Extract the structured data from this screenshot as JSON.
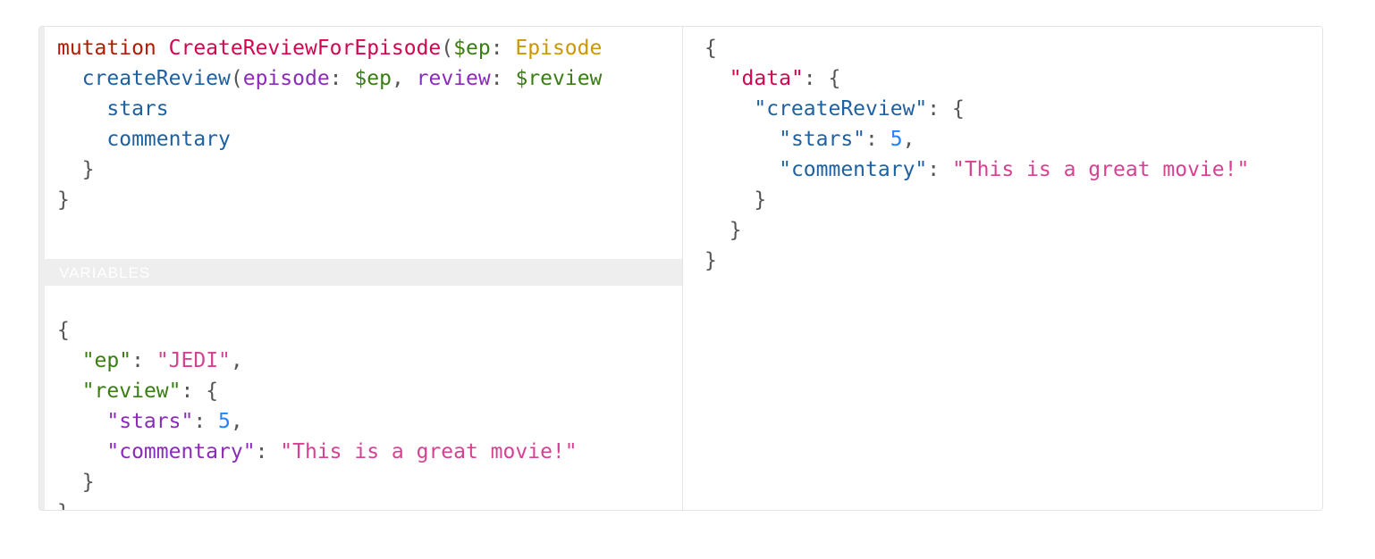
{
  "query": {
    "l1": {
      "keyword": "mutation",
      "name": "CreateReviewForEpisode",
      "open": "(",
      "var": "$ep",
      "colon": ":",
      "type": "Episode"
    },
    "l2": {
      "field": "createReview",
      "open": "(",
      "arg1": "episode",
      "colon1": ":",
      "var1": "$ep",
      "comma": ",",
      "arg2": "review",
      "colon2": ":",
      "var2": "$review"
    },
    "l3": {
      "field": "stars"
    },
    "l4": {
      "field": "commentary"
    },
    "l5": {
      "close": "}"
    },
    "l6": {
      "close": "}"
    }
  },
  "variables": {
    "label": "VARIABLES",
    "l1": "{",
    "l2": {
      "key": "\"ep\"",
      "colon": ":",
      "value": "\"JEDI\"",
      "comma": ","
    },
    "l3": {
      "key": "\"review\"",
      "colon": ":",
      "open": "{"
    },
    "l4": {
      "key": "\"stars\"",
      "colon": ":",
      "value": "5",
      "comma": ","
    },
    "l5": {
      "key": "\"commentary\"",
      "colon": ":",
      "value": "\"This is a great movie!\""
    },
    "l6": "}",
    "l7": "}"
  },
  "result": {
    "l1": "{",
    "l2": {
      "key": "\"data\"",
      "colon": ":",
      "open": "{"
    },
    "l3": {
      "key": "\"createReview\"",
      "colon": ":",
      "open": "{"
    },
    "l4": {
      "key": "\"stars\"",
      "colon": ":",
      "value": "5",
      "comma": ","
    },
    "l5": {
      "key": "\"commentary\"",
      "colon": ":",
      "value": "\"This is a great movie!\""
    },
    "l6": "}",
    "l7": "}",
    "l8": "}"
  },
  "colors": {
    "keyword": "#b11a04",
    "definition": "#d2054e",
    "variable": "#397d13",
    "type": "#ca9800",
    "field": "#1f61a0",
    "argument": "#8b2bb9",
    "string": "#d64292",
    "number": "#2882f9",
    "punctuation": "#555555"
  }
}
